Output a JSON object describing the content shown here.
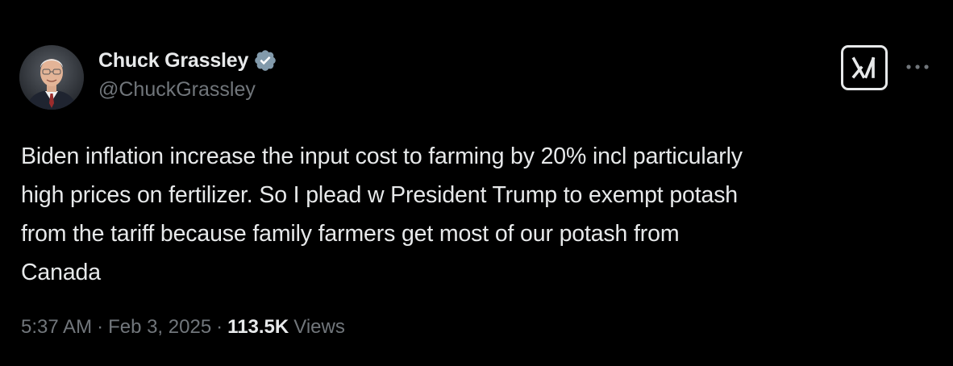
{
  "author": {
    "display_name": "Chuck Grassley",
    "handle": "@ChuckGrassley",
    "verified": true,
    "avatar": "profile-photo"
  },
  "icons": {
    "verified": "verified-badge-icon",
    "grok": "grok-icon",
    "more": "more-options-icon"
  },
  "colors": {
    "background": "#000000",
    "text": "#e7e9ea",
    "muted": "#71767b",
    "verified_badge": "#829aab"
  },
  "tweet": {
    "text": "Biden inflation increase the input cost to farming by 20% incl particularly\nhigh prices on fertilizer. So I plead w President Trump to exempt potash\nfrom the tariff because family farmers get most of our potash from\nCanada"
  },
  "meta": {
    "time": "5:37 AM",
    "separator": "·",
    "date": "Feb 3, 2025",
    "views_count": "113.5K",
    "views_label": "Views"
  }
}
